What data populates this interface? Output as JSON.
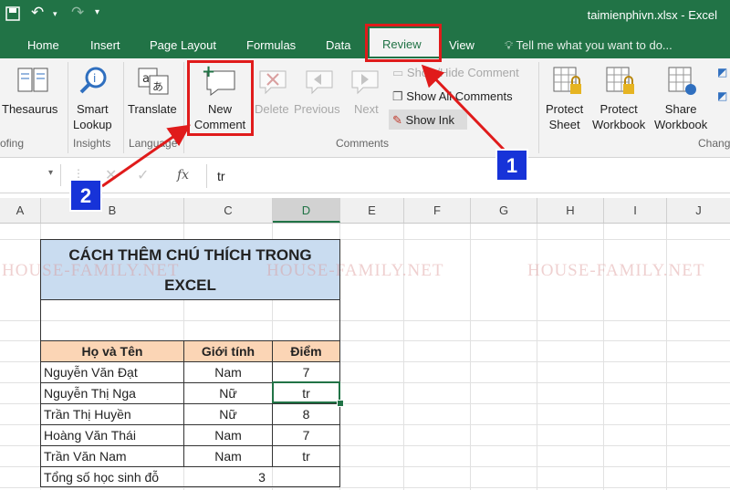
{
  "window": {
    "title": "taimienphivn.xlsx - Excel"
  },
  "tabs": [
    {
      "label": "Home"
    },
    {
      "label": "Insert"
    },
    {
      "label": "Page Layout"
    },
    {
      "label": "Formulas"
    },
    {
      "label": "Data"
    },
    {
      "label": "Review"
    },
    {
      "label": "View"
    }
  ],
  "tell_me": "Tell me what you want to do...",
  "ribbon": {
    "thesaurus": "Thesaurus",
    "smart_lookup_1": "Smart",
    "smart_lookup_2": "Lookup",
    "translate": "Translate",
    "new_comment_1": "New",
    "new_comment_2": "Comment",
    "delete": "Delete",
    "previous": "Previous",
    "next": "Next",
    "show_hide_comment": "Show/Hide Comment",
    "show_all_comments": "Show All Comments",
    "show_ink": "Show Ink",
    "protect_sheet_1": "Protect",
    "protect_sheet_2": "Sheet",
    "protect_workbook_1": "Protect",
    "protect_workbook_2": "Workbook",
    "share_workbook_1": "Share",
    "share_workbook_2": "Workbook",
    "groups": {
      "proofing": "ofing",
      "insights": "Insights",
      "language": "Language",
      "comments": "Comments",
      "changes": "Chang"
    }
  },
  "formula_bar": {
    "fx": "fx",
    "content": "tr"
  },
  "columns": [
    "A",
    "B",
    "C",
    "D",
    "E",
    "F",
    "G",
    "H",
    "I",
    "J"
  ],
  "sheet": {
    "title_line1": "CÁCH THÊM CHÚ THÍCH TRONG",
    "title_line2": "EXCEL",
    "headers": [
      "Họ và Tên",
      "Giới tính",
      "Điểm"
    ],
    "rows": [
      [
        "Nguyễn Văn Đạt",
        "Nam",
        "7"
      ],
      [
        "Nguyễn Thị Nga",
        "Nữ",
        "tr"
      ],
      [
        "Trần Thị Huyền",
        "Nữ",
        "8"
      ],
      [
        "Hoàng Văn Thái",
        "Nam",
        "7"
      ],
      [
        "Trần Văn Nam",
        "Nam",
        "tr"
      ]
    ],
    "total_label": "Tổng số học sinh đỗ",
    "total_value": "3"
  },
  "watermark": [
    "HOUSE-FAMILY.NET",
    "HOUSE-FAMILY.NET",
    "HOUSE-FAMILY.NET"
  ],
  "annotations": {
    "step1": "1",
    "step2": "2"
  },
  "colors": {
    "excel_green": "#217346",
    "annotation_red": "#e01b1b",
    "badge_blue": "#1733d8"
  }
}
